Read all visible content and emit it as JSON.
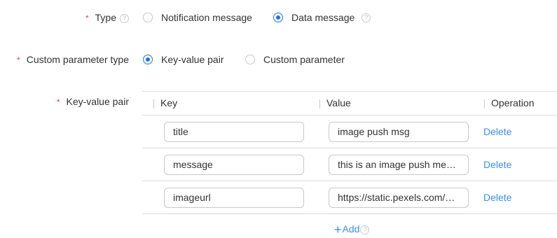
{
  "type": {
    "label": "Type",
    "help_icon": "question-circle-icon",
    "options": [
      {
        "label": "Notification message",
        "selected": false
      },
      {
        "label": "Data message",
        "selected": true
      }
    ]
  },
  "custom_param": {
    "label": "Custom parameter type",
    "options": [
      {
        "label": "Key-value pair",
        "selected": true
      },
      {
        "label": "Custom parameter",
        "selected": false
      }
    ]
  },
  "kv": {
    "label": "Key-value pair",
    "columns": {
      "key": "Key",
      "value": "Value",
      "operation": "Operation"
    },
    "rows": [
      {
        "key": "title",
        "value": "image push msg",
        "action": "Delete"
      },
      {
        "key": "message",
        "value": "this is an image push me…",
        "action": "Delete"
      },
      {
        "key": "imageurl",
        "value": "https://static.pexels.com/…",
        "action": "Delete"
      }
    ],
    "add_label": "Add"
  },
  "required_mark": "*",
  "help_glyph": "?",
  "colors": {
    "accent": "#1a73e8",
    "link": "#3d8ee6",
    "required": "#e64545",
    "border": "#c8c8c8"
  }
}
